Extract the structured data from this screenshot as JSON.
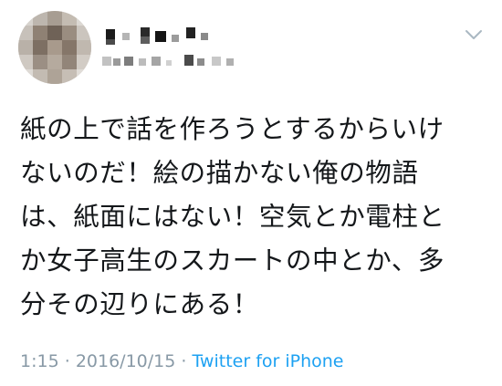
{
  "tweet": {
    "avatar_icon": "pixelated-avatar",
    "display_name": "",
    "handle": "",
    "menu_icon": "chevron-down-icon",
    "text_lines": [
      "紙の上で話を作ろうとするからいけ",
      "ないのだ！絵の描かない俺の物語",
      "は、紙面にはない！空気とか電柱と",
      "か女子高生のスカートの中とか、多",
      "分その辺りにある！"
    ],
    "time": "1:15",
    "separator": "·",
    "date": "2016/10/15",
    "source": "Twitter for iPhone",
    "colors": {
      "text": "#14171a",
      "meta": "#8899a6",
      "link": "#1da1f2"
    }
  }
}
